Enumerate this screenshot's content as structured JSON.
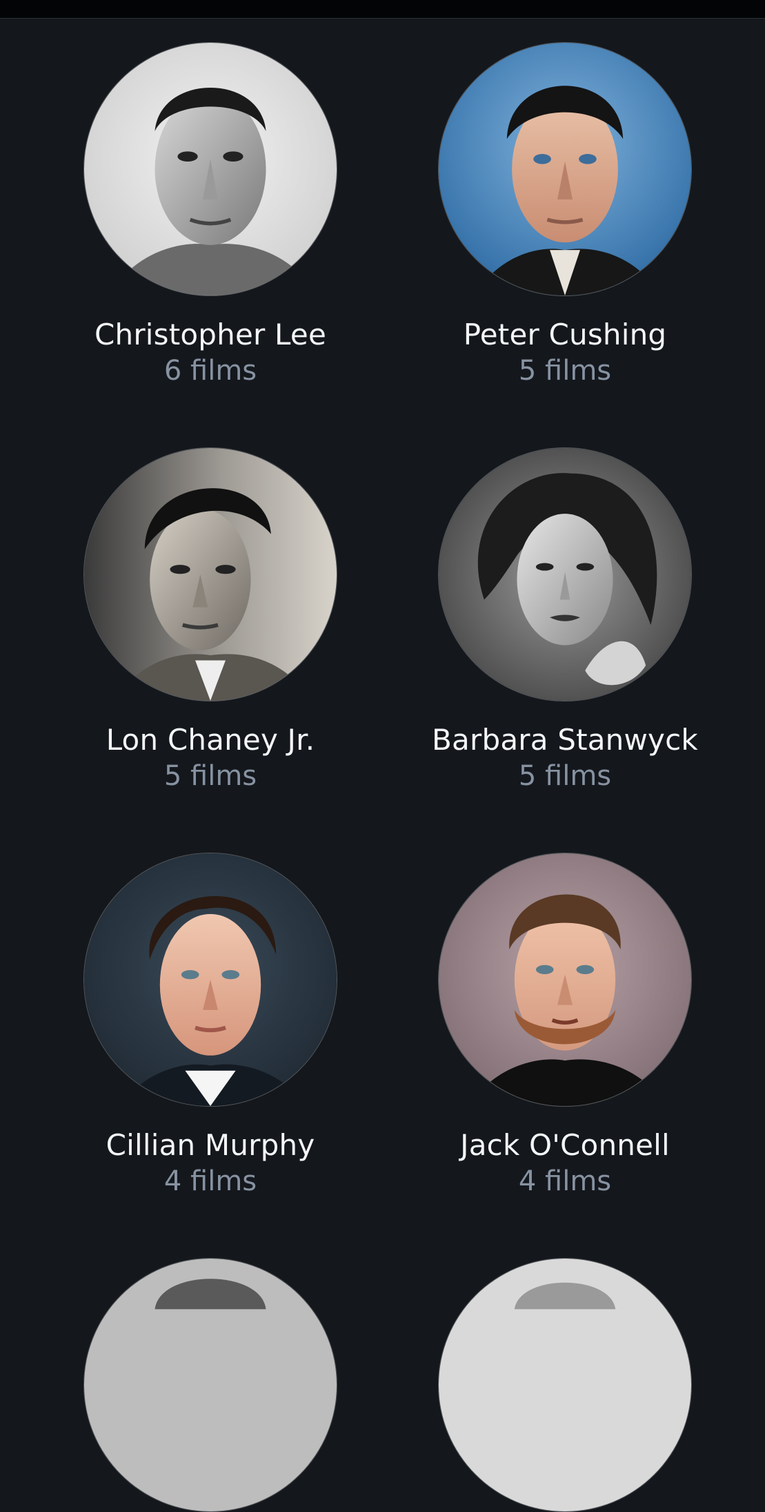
{
  "people": [
    {
      "name": "Christopher Lee",
      "count": "6 films",
      "portrait": "portrait-bw-man-1"
    },
    {
      "name": "Peter Cushing",
      "count": "5 films",
      "portrait": "portrait-color-man-blue"
    },
    {
      "name": "Lon Chaney Jr.",
      "count": "5 films",
      "portrait": "portrait-bw-man-2"
    },
    {
      "name": "Barbara Stanwyck",
      "count": "5 films",
      "portrait": "portrait-bw-woman"
    },
    {
      "name": "Cillian Murphy",
      "count": "4 films",
      "portrait": "portrait-color-man-dark"
    },
    {
      "name": "Jack O'Connell",
      "count": "4 films",
      "portrait": "portrait-color-man-beard"
    }
  ],
  "colors": {
    "background": "#14181d",
    "name_text": "#f4f6f8",
    "count_text": "#8792a1"
  }
}
